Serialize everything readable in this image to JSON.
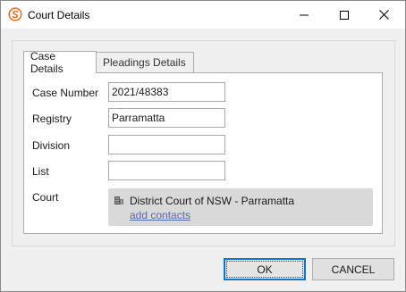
{
  "window": {
    "title": "Court Details"
  },
  "tabs": [
    {
      "label": "Case Details",
      "selected": true
    },
    {
      "label": "Pleadings Details",
      "selected": false
    }
  ],
  "form": {
    "case_number": {
      "label": "Case Number",
      "value": "2021/48383"
    },
    "registry": {
      "label": "Registry",
      "value": "Parramatta"
    },
    "division": {
      "label": "Division",
      "value": ""
    },
    "list": {
      "label": "List",
      "value": ""
    },
    "court": {
      "label": "Court",
      "name": "District Court of NSW - Parramatta",
      "link": "add contacts",
      "icon": "building-icon"
    }
  },
  "buttons": {
    "ok": "OK",
    "cancel": "CANCEL"
  },
  "colors": {
    "accent": "#0078d7",
    "app_icon": "#e8742a",
    "link": "#4a6ea8",
    "court_box_bg": "#d9d9d9"
  }
}
